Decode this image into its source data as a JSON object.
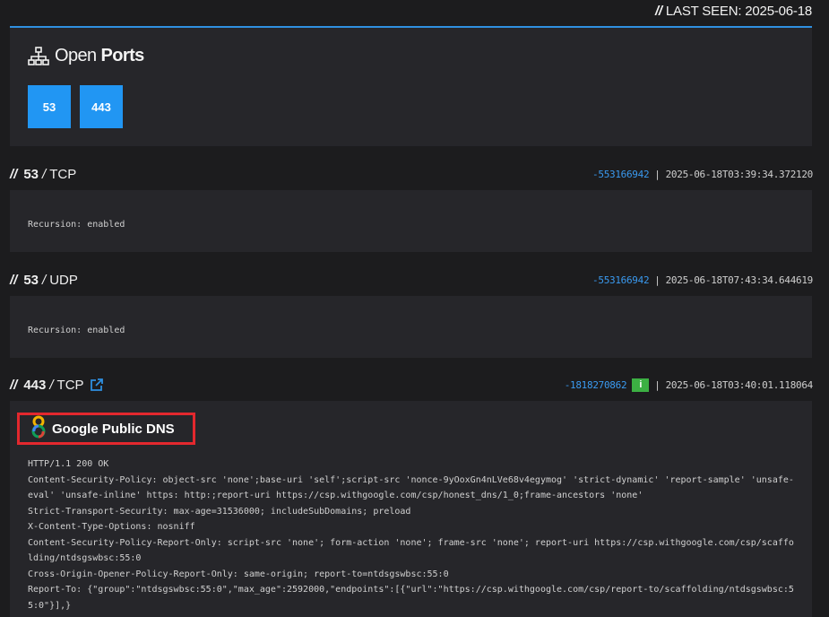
{
  "last_seen": {
    "prefix": "//",
    "text": "LAST SEEN: 2025-06-18"
  },
  "open_ports": {
    "title_light": "Open",
    "title_bold": "Ports",
    "icon": "network-icon",
    "ports": [
      "53",
      "443"
    ]
  },
  "services": [
    {
      "slashes": "//",
      "port": "53",
      "sep": "/",
      "proto": "TCP",
      "hash": "-553166942",
      "pipe": "|",
      "timestamp": "2025-06-18T03:39:34.372120",
      "data": "Recursion: enabled"
    },
    {
      "slashes": "//",
      "port": "53",
      "sep": "/",
      "proto": "UDP",
      "hash": "-553166942",
      "pipe": "|",
      "timestamp": "2025-06-18T07:43:34.644619",
      "data": "Recursion: enabled"
    },
    {
      "slashes": "//",
      "port": "443",
      "sep": "/",
      "proto": "TCP",
      "hash": "-1818270862",
      "info_badge": "i",
      "pipe": "|",
      "timestamp": "2025-06-18T03:40:01.118064",
      "product": {
        "logo": "8",
        "name": "Google Public DNS"
      },
      "http_lines": [
        "HTTP/1.1 200 OK",
        "Content-Security-Policy: object-src 'none';base-uri 'self';script-src 'nonce-9yOoxGn4nLVe68v4egymog' 'strict-dynamic' 'report-sample' 'unsafe-eval' 'unsafe-inline' https: http:;report-uri https://csp.withgoogle.com/csp/honest_dns/1_0;frame-ancestors 'none'",
        "Strict-Transport-Security: max-age=31536000; includeSubDomains; preload",
        "X-Content-Type-Options: nosniff",
        "Content-Security-Policy-Report-Only: script-src 'none'; form-action 'none'; frame-src 'none'; report-uri https://csp.withgoogle.com/csp/scaffolding/ntdsgswbsc:55:0",
        "Cross-Origin-Opener-Policy-Report-Only: same-origin; report-to=ntdsgswbsc:55:0",
        "Report-To: {\"group\":\"ntdsgswbsc:55:0\",\"max_age\":2592000,\"endpoints\":[{\"url\":\"https://csp.withgoogle.com/csp/report-to/scaffolding/ntdsgswbsc:55:0\"}],}"
      ]
    }
  ],
  "colors": {
    "accent": "#2196f3",
    "hash": "#3a9af0",
    "badge": "#3cb043",
    "highlight": "#e3282e"
  }
}
